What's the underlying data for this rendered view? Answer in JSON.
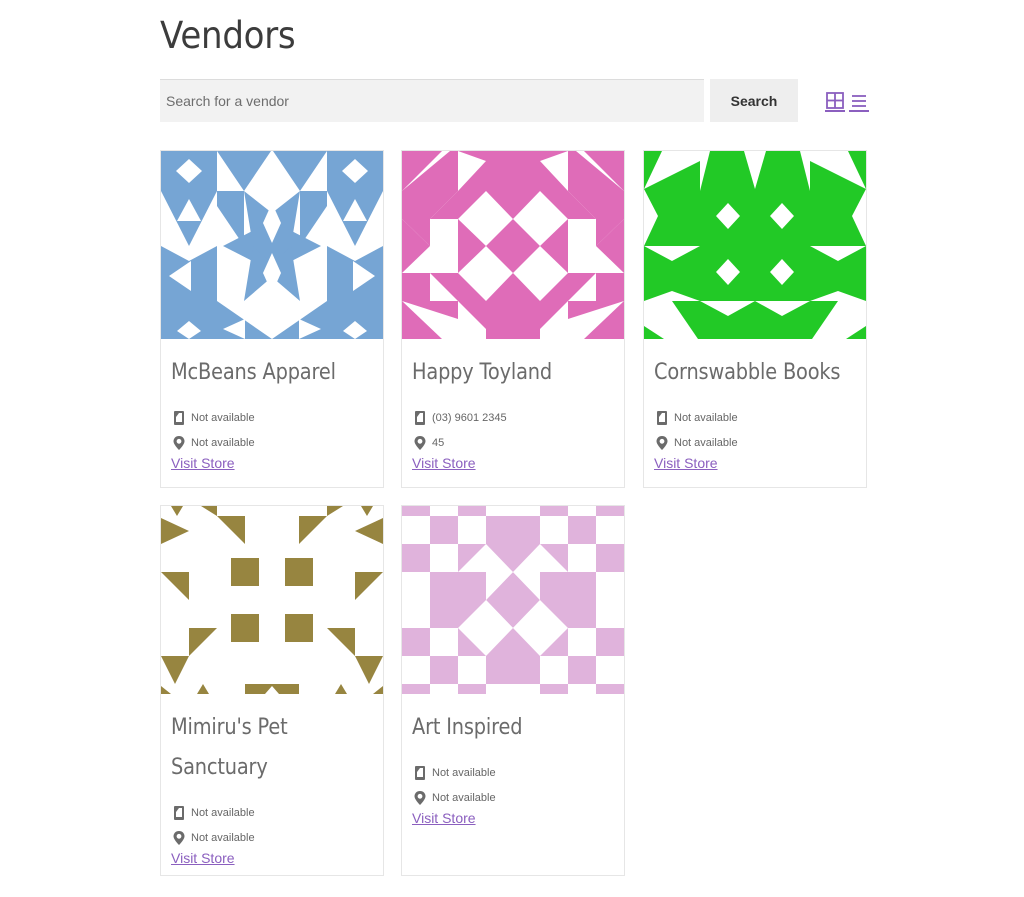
{
  "page": {
    "title": "Vendors"
  },
  "search": {
    "placeholder": "Search for a vendor",
    "value": "",
    "button_label": "Search"
  },
  "view_toggle": {
    "options": [
      "grid",
      "list"
    ],
    "active": "grid",
    "accent": "#8b5fbf"
  },
  "vendors": [
    {
      "name": "McBeans Apparel",
      "phone": "Not available",
      "address": "Not available",
      "link": "Visit Store",
      "avatar_color": "#76a5d4"
    },
    {
      "name": "Happy Toyland",
      "phone": "(03) 9601 2345",
      "address": "45",
      "link": "Visit Store",
      "avatar_color": "#df6cb8"
    },
    {
      "name": "Cornswabble Books",
      "phone": "Not available",
      "address": "Not available",
      "link": "Visit Store",
      "avatar_color": "#22c926"
    },
    {
      "name": "Mimiru's Pet Sanctuary",
      "name_lines": [
        "Mimiru's Pet",
        "Sanctuary"
      ],
      "phone": "Not available",
      "address": "Not available",
      "link": "Visit Store",
      "avatar_color": "#978540"
    },
    {
      "name": "Art Inspired",
      "phone": "Not available",
      "address": "Not available",
      "link": "Visit Store",
      "avatar_color": "#e0b3dc"
    }
  ]
}
